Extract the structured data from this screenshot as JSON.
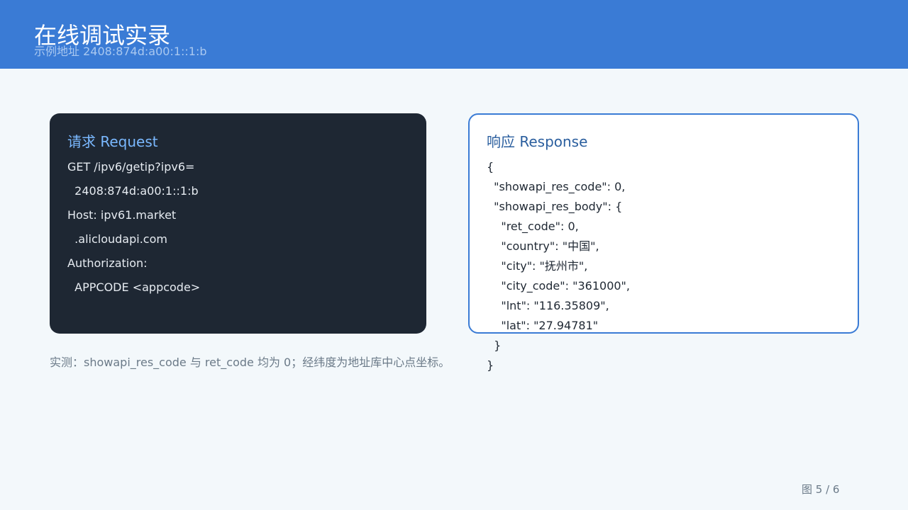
{
  "header": {
    "title": "在线调试实录",
    "subtitle": "示例地址 2408:874d:a00:1::1:b"
  },
  "request": {
    "heading": "请求 Request",
    "lines": [
      "GET /ipv6/getip?ipv6=",
      "  2408:874d:a00:1::1:b",
      "Host: ipv61.market",
      "  .alicloudapi.com",
      "Authorization:",
      "  APPCODE <appcode>"
    ]
  },
  "response": {
    "heading": "响应 Response",
    "lines": [
      "{",
      "  \"showapi_res_code\": 0,",
      "  \"showapi_res_body\": {",
      "    \"ret_code\": 0,",
      "    \"country\": \"中国\",",
      "    \"city\": \"抚州市\",",
      "    \"city_code\": \"361000\",",
      "    \"lnt\": \"116.35809\",",
      "    \"lat\": \"27.94781\"",
      "  }",
      "}"
    ]
  },
  "caption": "实测：showapi_res_code 与 ret_code 均为 0；经纬度为地址库中心点坐标。",
  "footer": {
    "page_indicator": "图 5 / 6"
  },
  "colors": {
    "header_bar": "#3a7bd5",
    "request_card": "#1e2733",
    "request_heading": "#7ab8ff",
    "response_border": "#3a7bd5",
    "response_heading": "#2a5e9e"
  }
}
